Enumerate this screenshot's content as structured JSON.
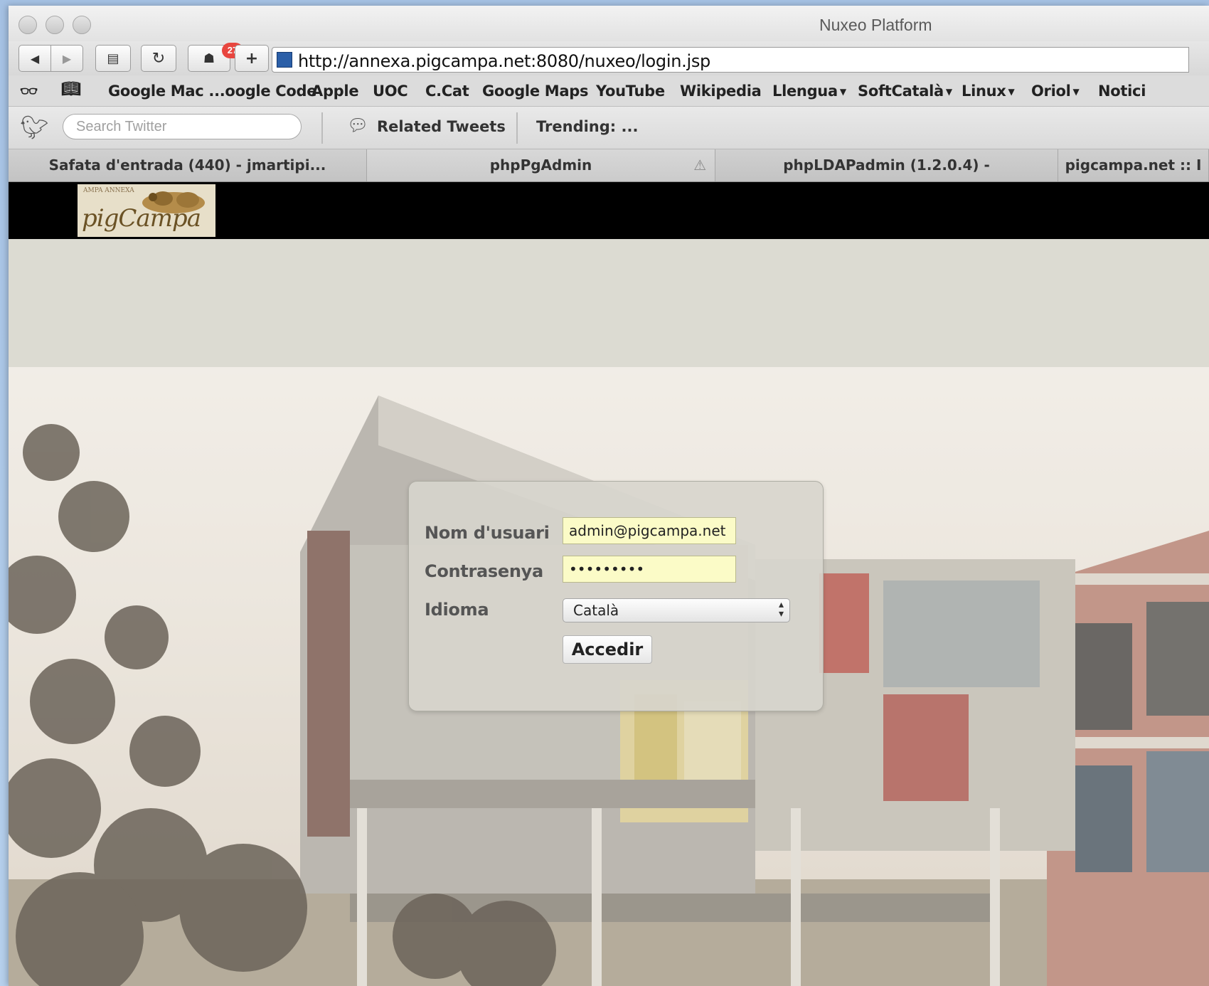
{
  "window": {
    "title": "Nuxeo Platform"
  },
  "toolbar": {
    "back_icon": "back-arrow-icon",
    "forward_icon": "forward-arrow-icon",
    "notification_count": "27",
    "add_label": "+",
    "url": "http://annexa.pigcampa.net:8080/nuxeo/login.jsp"
  },
  "bookmarks": [
    {
      "label": "Google Mac ...oogle Code"
    },
    {
      "label": "Apple"
    },
    {
      "label": "UOC"
    },
    {
      "label": "C.Cat"
    },
    {
      "label": "Google Maps"
    },
    {
      "label": "YouTube"
    },
    {
      "label": "Wikipedia"
    },
    {
      "label": "Llengua"
    },
    {
      "label": "SoftCatalà"
    },
    {
      "label": "Linux"
    },
    {
      "label": "Oriol"
    },
    {
      "label": "Notici"
    }
  ],
  "twitter": {
    "search_placeholder": "Search Twitter",
    "related": "Related Tweets",
    "trending": "Trending: ..."
  },
  "tabs": [
    {
      "label": "Safata d'entrada (440) - jmartipi..."
    },
    {
      "label": "phpPgAdmin"
    },
    {
      "label": "phpLDAPadmin (1.2.0.4) -"
    },
    {
      "label": "pigcampa.net :: I"
    }
  ],
  "logo": {
    "small_text": "AMPA ANNEXA",
    "name": "pigCampa"
  },
  "login": {
    "username_label": "Nom d'usuari",
    "username_value": "admin@pigcampa.net",
    "password_label": "Contrasenya",
    "password_value": "•••••••••",
    "language_label": "Idioma",
    "language_value": "Català",
    "submit_label": "Accedir"
  },
  "colors": {
    "header": "#000000",
    "page_bg": "#dcdbd2",
    "input_bg": "#fbfbc7",
    "badge": "#e8463f"
  }
}
